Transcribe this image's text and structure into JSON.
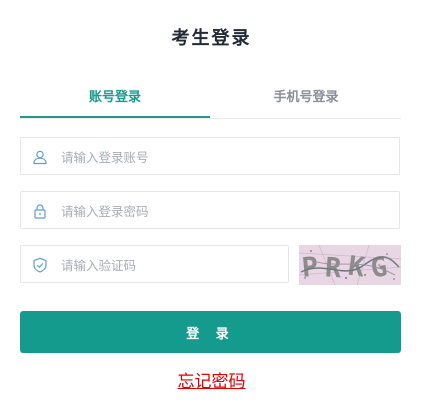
{
  "title": "考生登录",
  "tabs": [
    {
      "label": "账号登录",
      "active": true
    },
    {
      "label": "手机号登录",
      "active": false
    }
  ],
  "fields": {
    "account": {
      "placeholder": "请输入登录账号",
      "value": "",
      "icon": "user-icon"
    },
    "password": {
      "placeholder": "请输入登录密码",
      "value": "",
      "icon": "lock-icon"
    },
    "captcha": {
      "placeholder": "请输入验证码",
      "value": "",
      "icon": "shield-icon"
    }
  },
  "captcha_image": {
    "text": "PRKG"
  },
  "login_button": "登 录",
  "forgot_link": "忘记密码",
  "colors": {
    "accent": "#159b8e",
    "link": "#e00000",
    "title": "#222a35"
  }
}
